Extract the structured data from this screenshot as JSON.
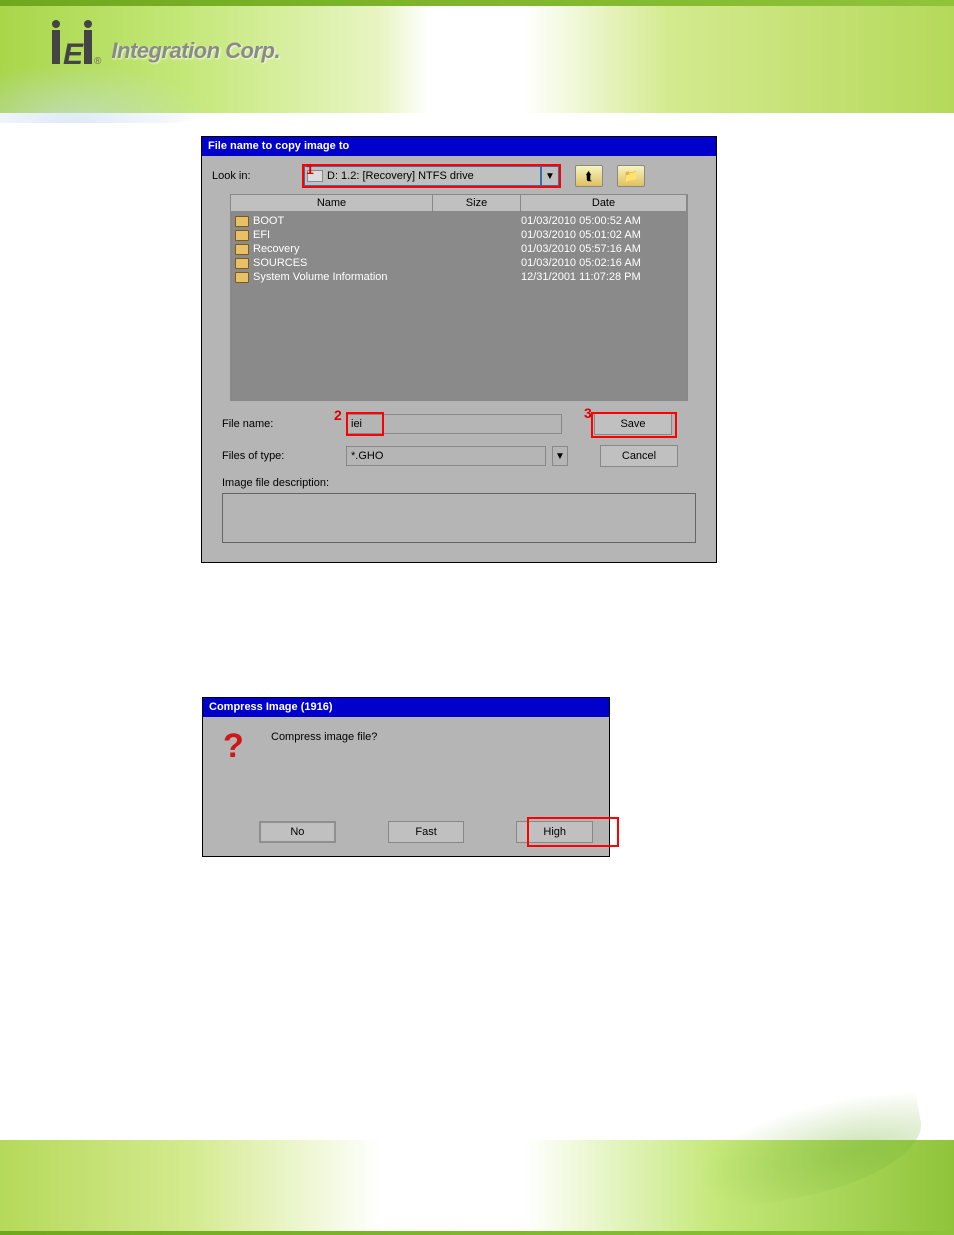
{
  "header": {
    "brand": "Integration Corp."
  },
  "dialog1": {
    "title": "File name to copy image to",
    "look_in_label": "Look in:",
    "look_in_value": "D: 1.2: [Recovery] NTFS drive",
    "columns": {
      "name": "Name",
      "size": "Size",
      "date": "Date"
    },
    "files": [
      {
        "name": "BOOT",
        "size": "",
        "date": "01/03/2010 05:00:52 AM"
      },
      {
        "name": "EFI",
        "size": "",
        "date": "01/03/2010 05:01:02 AM"
      },
      {
        "name": "Recovery",
        "size": "",
        "date": "01/03/2010 05:57:16 AM"
      },
      {
        "name": "SOURCES",
        "size": "",
        "date": "01/03/2010 05:02:16 AM"
      },
      {
        "name": "System Volume Information",
        "size": "",
        "date": "12/31/2001 11:07:28 PM"
      }
    ],
    "file_name_label": "File name:",
    "file_name_value": "iei",
    "files_of_type_label": "Files of type:",
    "files_of_type_value": "*.GHO",
    "image_desc_label": "Image file description:",
    "save_btn": "Save",
    "cancel_btn": "Cancel",
    "annot1": "1",
    "annot2": "2",
    "annot3": "3"
  },
  "dialog2": {
    "title": "Compress Image (1916)",
    "prompt": "Compress image file?",
    "no_btn": "No",
    "fast_btn": "Fast",
    "high_btn": "High"
  }
}
